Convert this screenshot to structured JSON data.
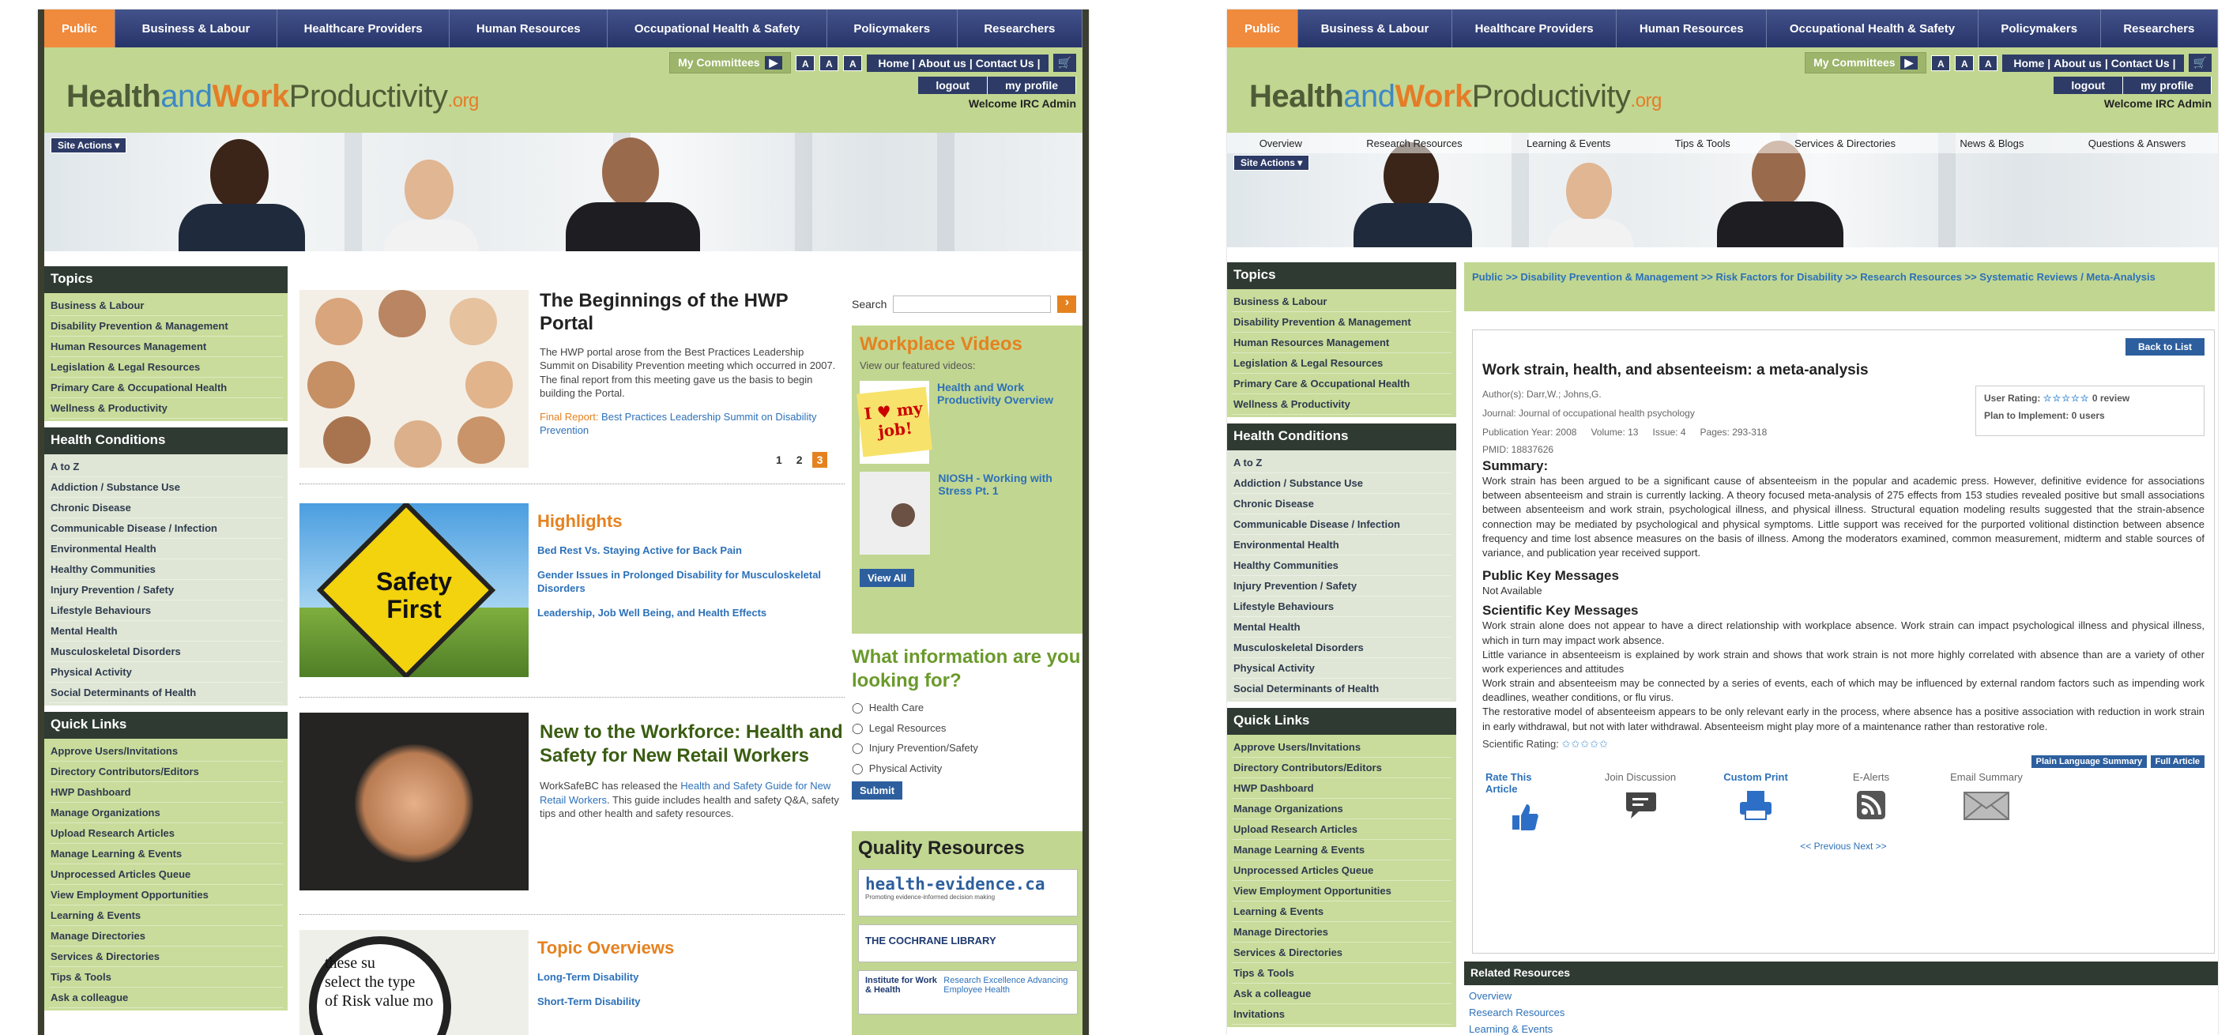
{
  "nav": [
    "Public",
    "Business & Labour",
    "Healthcare Providers",
    "Human Resources",
    "Occupational Health & Safety",
    "Policymakers",
    "Researchers"
  ],
  "logo": {
    "health": "Health",
    "and": "and",
    "work": "Work",
    "productivity": "Productivity",
    ".org": ".org"
  },
  "header": {
    "my_committees": "My Committees",
    "font_sizes": [
      "A",
      "A",
      "A"
    ],
    "links": [
      "Home",
      "About us",
      "Contact Us"
    ],
    "logout": "logout",
    "my_profile": "my profile",
    "welcome": "Welcome IRC Admin"
  },
  "site_actions": "Site Actions",
  "subnav": [
    "Overview",
    "Research Resources",
    "Learning & Events",
    "Tips & Tools",
    "Services & Directories",
    "News & Blogs",
    "Questions & Answers"
  ],
  "sidebar": {
    "topics_title": "Topics",
    "topics": [
      "Business & Labour",
      "Disability Prevention & Management",
      "Human Resources Management",
      "Legislation & Legal Resources",
      "Primary Care & Occupational Health",
      "Wellness & Productivity"
    ],
    "health_title": "Health Conditions",
    "health": [
      "A to Z",
      "Addiction / Substance Use",
      "Chronic Disease",
      "Communicable Disease / Infection",
      "Environmental Health",
      "Healthy Communities",
      "Injury Prevention / Safety",
      "Lifestyle Behaviours",
      "Mental Health",
      "Musculoskeletal Disorders",
      "Physical Activity",
      "Social Determinants of Health"
    ],
    "quick_title": "Quick Links",
    "quick_left": [
      "Approve Users/Invitations",
      "Directory Contributors/Editors",
      "HWP Dashboard",
      "Manage Organizations",
      "Upload Research Articles",
      "Manage Learning & Events",
      "Unprocessed Articles Queue",
      "View Employment Opportunities",
      "Learning & Events",
      "Manage Directories",
      "Services & Directories",
      "Tips & Tools",
      "Ask a colleague"
    ],
    "quick_right": [
      "Approve Users/Invitations",
      "Directory Contributors/Editors",
      "HWP Dashboard",
      "Manage Organizations",
      "Upload Research Articles",
      "Manage Learning & Events",
      "Unprocessed Articles Queue",
      "View Employment Opportunities",
      "Learning & Events",
      "Manage Directories",
      "Services & Directories",
      "Tips & Tools",
      "Ask a colleague",
      "Invitations"
    ]
  },
  "home": {
    "feature": {
      "title": "The Beginnings of the HWP Portal",
      "body": "The HWP portal arose from the Best Practices Leadership Summit on Disability Prevention meeting which occurred in 2007. The final report from this meeting gave us the basis to begin building the Portal.",
      "final_label": "Final Report:",
      "final_link": "Best Practices Leadership Summit on Disability Prevention",
      "pages": [
        "1",
        "2",
        "3"
      ]
    },
    "highlights": {
      "title": "Highlights",
      "items": [
        "Bed Rest Vs. Staying Active for Back Pain",
        "Gender Issues in Prolonged Disability for Musculoskeletal Disorders",
        "Leadership, Job Well Being, and Health Effects"
      ],
      "sign_line1": "Safety",
      "sign_line2": "First"
    },
    "workforce": {
      "title": "New to the Workforce: Health and Safety for New Retail Workers",
      "body_pre": "WorkSafeBC has released the ",
      "body_link": "Health and Safety Guide for New Retail Workers",
      "body_post": ". This guide includes health and safety Q&A, safety tips and other health and safety resources."
    },
    "topic_overviews": {
      "title": "Topic Overviews",
      "items": [
        "Long-Term Disability",
        "Short-Term Disability"
      ],
      "lens_lines": [
        "these su",
        "select the type",
        "of Risk value mo"
      ]
    },
    "search_label": "Search",
    "videos": {
      "title": "Workplace Videos",
      "sub": "View our featured videos:",
      "items": [
        "Health and Work Productivity Overview",
        "NIOSH - Working with Stress Pt. 1"
      ],
      "view_all": "View All",
      "note_text": "I ♥ my job!"
    },
    "info": {
      "title": "What information are you looking for?",
      "options": [
        "Health Care",
        "Legal Resources",
        "Injury Prevention/Safety",
        "Physical Activity"
      ],
      "submit": "Submit"
    },
    "quality": {
      "title": "Quality Resources",
      "logos": [
        "health-evidence.ca",
        "THE COCHRANE LIBRARY",
        "Institute for Work & Health"
      ],
      "logo_sub": "Promoting evidence-informed decision making",
      "iwh_tag": "Research Excellence Advancing Employee Health"
    }
  },
  "article": {
    "breadcrumb": "Public >> Disability Prevention & Management >> Risk Factors for Disability >> Research Resources >> Systematic Reviews / Meta-Analysis",
    "back": "Back to List",
    "title": "Work strain, health, and absenteeism: a meta-analysis",
    "authors": "Author(s): Darr,W.; Johns,G.",
    "journal": "Journal: Journal of occupational health psychology",
    "pubyear": "Publication Year: 2008",
    "volume": "Volume: 13",
    "issue": "Issue: 4",
    "pages": "Pages: 293-318",
    "pmid": "PMID: 18837626",
    "user_rating": "User Rating:",
    "reviews": "0 review",
    "plan": "Plan to Implement: 0 users",
    "summary_h": "Summary:",
    "summary": "Work strain has been argued to be a significant cause of absenteeism in the popular and academic press. However, definitive evidence for associations between absenteeism and strain is currently lacking. A theory focused meta-analysis of 275 effects from 153 studies revealed positive but small associations between absenteeism and work strain, psychological illness, and physical illness. Structural equation modeling results suggested that the strain-absence connection may be mediated by psychological and physical symptoms. Little support was received for the purported volitional distinction between absence frequency and time lost absence measures on the basis of illness. Among the moderators examined, common measurement, midterm and stable sources of variance, and publication year received support.",
    "pkm_h": "Public Key Messages",
    "pkm": "Not Available",
    "skm_h": "Scientific Key Messages",
    "skm": [
      "Work strain alone does not appear to have a direct relationship with workplace absence. Work strain can impact psychological illness and physical illness, which in turn may impact work absence.",
      "Little variance in absenteeism is explained by work strain and shows that work strain is not more highly correlated with absence than are a variety of other work experiences and attitudes",
      "Work strain and absenteeism may be connected by a series of events, each of which may be influenced by external random factors such as impending work deadlines, weather conditions, or flu virus.",
      "The restorative model of absenteeism appears to be only relevant early in the process, where absence has a positive association with reduction in work strain in early withdrawal, but not with later withdrawal. Absenteeism might play more of a maintenance rather than restorative role."
    ],
    "sci_rating": "Scientific Rating:",
    "plain": "Plain Language Summary",
    "full": "Full Article",
    "actions": [
      "Rate This Article",
      "Join Discussion",
      "Custom Print",
      "E-Alerts",
      "Email Summary"
    ],
    "pager": "<< Previous Next >>",
    "related_h": "Related Resources",
    "related": [
      "Overview",
      "Research Resources",
      "Learning & Events"
    ]
  }
}
